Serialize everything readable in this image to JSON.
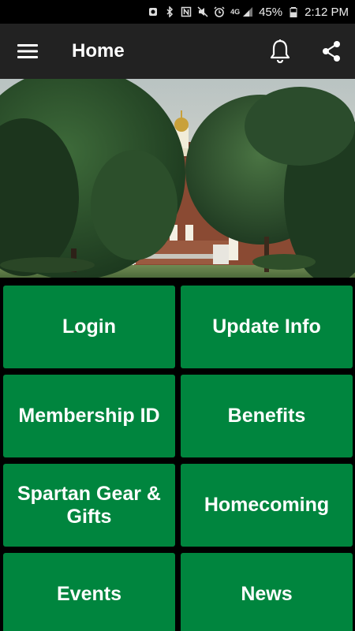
{
  "status_bar": {
    "battery_percent": "45%",
    "time": "2:12 PM",
    "network": "4G"
  },
  "app_bar": {
    "title": "Home",
    "menu_icon": "hamburger-menu-icon",
    "notification_icon": "bell-icon",
    "share_icon": "share-icon"
  },
  "hero": {
    "description": ""
  },
  "colors": {
    "tile_green": "#00853e",
    "appbar": "#222222"
  },
  "tiles": [
    {
      "label": "Login"
    },
    {
      "label": "Update Info"
    },
    {
      "label": "Membership ID"
    },
    {
      "label": "Benefits"
    },
    {
      "label": "Spartan Gear & Gifts"
    },
    {
      "label": "Homecoming"
    },
    {
      "label": "Events"
    },
    {
      "label": "News"
    }
  ]
}
